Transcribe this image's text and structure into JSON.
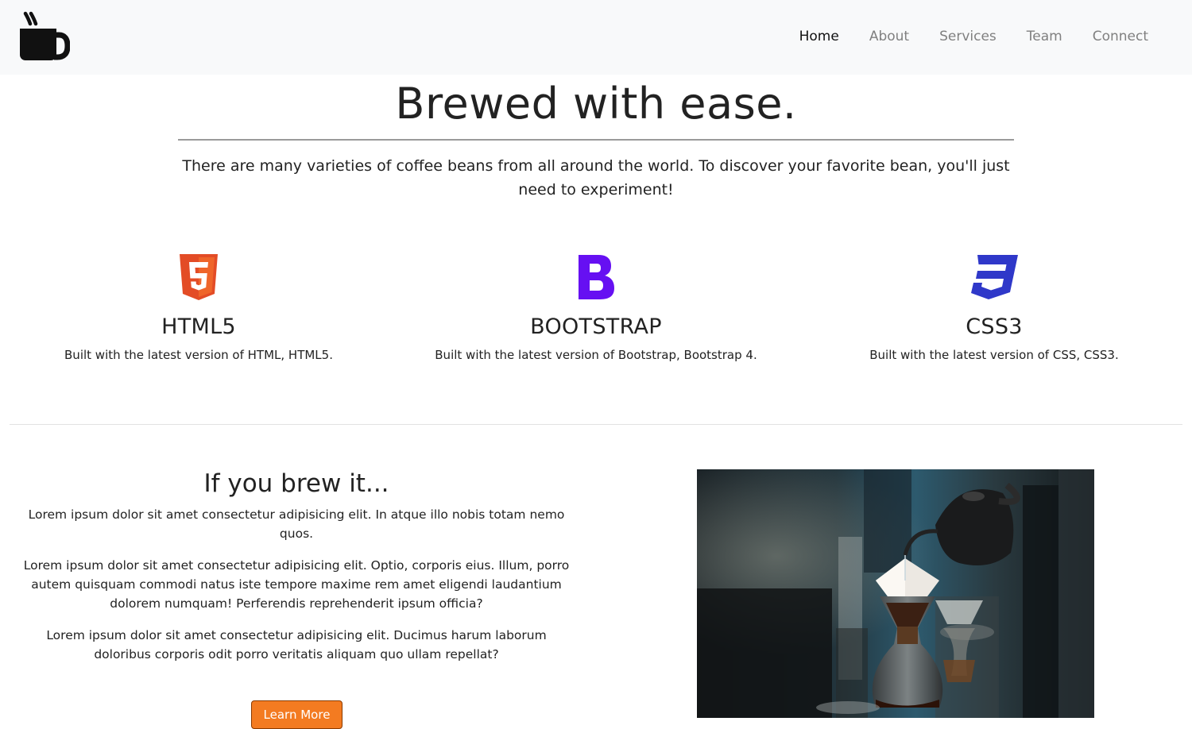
{
  "nav": {
    "brand_icon": "coffee-mug-icon",
    "links": [
      {
        "label": "Home",
        "active": true
      },
      {
        "label": "About",
        "active": false
      },
      {
        "label": "Services",
        "active": false
      },
      {
        "label": "Team",
        "active": false
      },
      {
        "label": "Connect",
        "active": false
      }
    ]
  },
  "hero": {
    "title": "Brewed with ease.",
    "subtitle": "There are many varieties of coffee beans from all around the world. To discover your favorite bean, you'll just need to experiment!"
  },
  "features": [
    {
      "icon": "html5-icon",
      "title": "HTML5",
      "text": "Built with the latest version of HTML, HTML5.",
      "color": "#e34c26"
    },
    {
      "icon": "bootstrap-icon",
      "title": "BOOTSTRAP",
      "text": "Built with the latest version of Bootstrap, Bootstrap 4.",
      "color": "#6610f2"
    },
    {
      "icon": "css3-icon",
      "title": "CSS3",
      "text": "Built with the latest version of CSS, CSS3.",
      "color": "#2f38c9"
    }
  ],
  "about": {
    "title": "If you brew it...",
    "paragraphs": [
      "Lorem ipsum dolor sit amet consectetur adipisicing elit. In atque illo nobis totam nemo quos.",
      "Lorem ipsum dolor sit amet consectetur adipisicing elit. Optio, corporis eius. Illum, porro autem quisquam commodi natus iste tempore maxime rem amet eligendi laudantium dolorem numquam! Perferendis reprehenderit ipsum officia?",
      "Lorem ipsum dolor sit amet consectetur adipisicing elit. Ducimus harum laborum doloribus corporis odit porro veritatis aliquam quo ullam repellat?"
    ],
    "button_label": "Learn More",
    "button_color": "#f37b21",
    "photo": "pour-over-coffee-photo"
  }
}
